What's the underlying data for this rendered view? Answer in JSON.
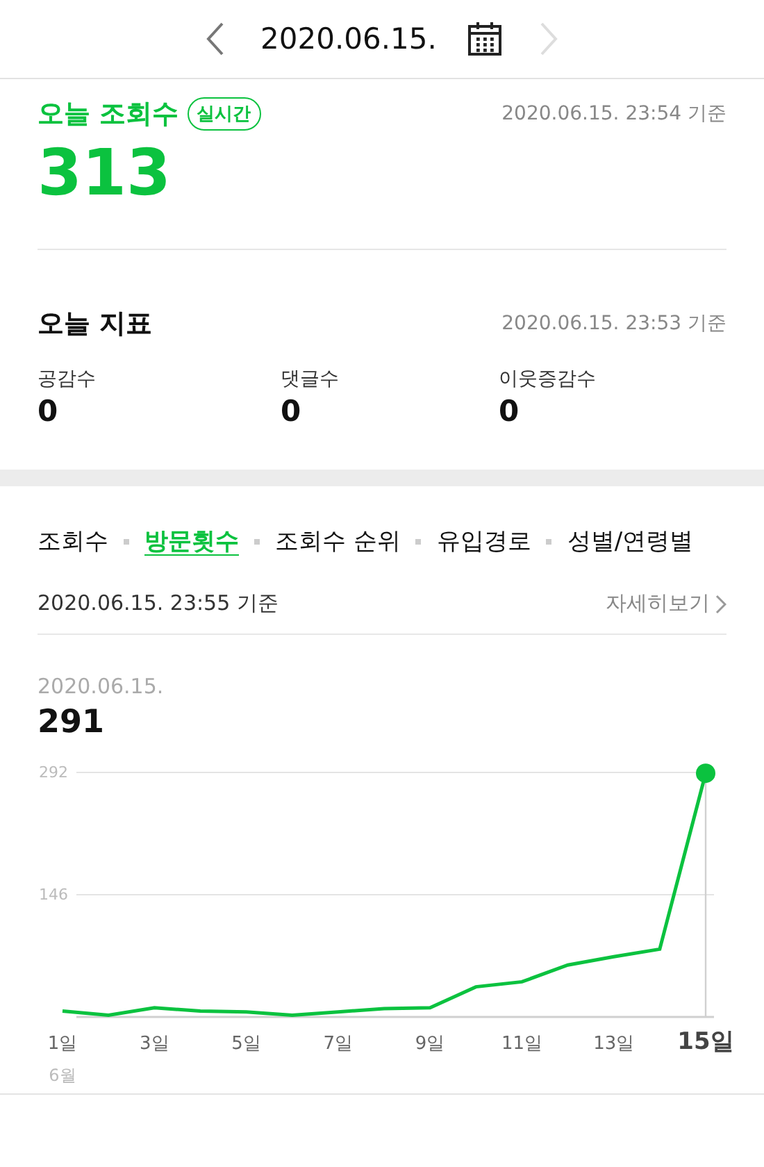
{
  "date_nav": {
    "date": "2020.06.15.",
    "next_disabled": true
  },
  "today_views": {
    "title": "오늘 조회수",
    "badge": "실시간",
    "timestamp": "2020.06.15. 23:54 기준",
    "value": "313"
  },
  "today_metrics": {
    "title": "오늘 지표",
    "timestamp": "2020.06.15. 23:53 기준",
    "items": [
      {
        "label": "공감수",
        "value": "0"
      },
      {
        "label": "댓글수",
        "value": "0"
      },
      {
        "label": "이웃증감수",
        "value": "0"
      }
    ]
  },
  "tabs": [
    {
      "label": "조회수",
      "selected": false
    },
    {
      "label": "방문횟수",
      "selected": true
    },
    {
      "label": "조회수 순위",
      "selected": false
    },
    {
      "label": "유입경로",
      "selected": false
    },
    {
      "label": "성별/연령별",
      "selected": false
    }
  ],
  "stats": {
    "timestamp": "2020.06.15. 23:55 기준",
    "detail_link": "자세히보기",
    "selected_date": "2020.06.15.",
    "selected_value": "291",
    "month_label": "6월",
    "chart_data": {
      "type": "line",
      "x": [
        1,
        2,
        3,
        4,
        5,
        6,
        7,
        8,
        9,
        10,
        11,
        12,
        13,
        14,
        15
      ],
      "series": [
        {
          "color": "#0bc23f",
          "values": [
            7,
            2,
            11,
            7,
            6,
            2,
            6,
            10,
            11,
            36,
            42,
            62,
            72,
            81,
            291
          ]
        }
      ],
      "xlim": [
        1,
        15
      ],
      "ylim": [
        0,
        292
      ],
      "yticks": [
        146,
        292
      ],
      "xticks": [
        {
          "value": 1,
          "label": "1일"
        },
        {
          "value": 3,
          "label": "3일"
        },
        {
          "value": 5,
          "label": "5일"
        },
        {
          "value": 7,
          "label": "7일"
        },
        {
          "value": 9,
          "label": "9일"
        },
        {
          "value": 11,
          "label": "11일"
        },
        {
          "value": 13,
          "label": "13일"
        },
        {
          "value": 15,
          "label": "15일"
        }
      ]
    }
  }
}
